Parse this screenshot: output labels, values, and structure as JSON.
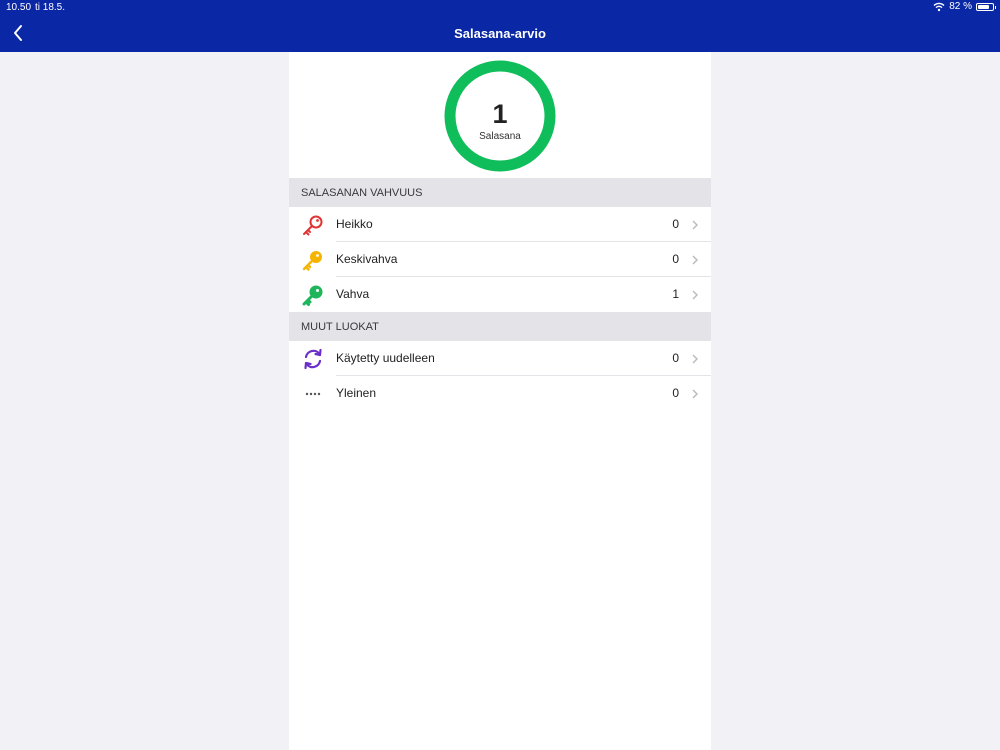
{
  "status_bar": {
    "time": "10.50",
    "date": "ti 18.5.",
    "battery": "82 %",
    "battery_level": 0.82
  },
  "nav": {
    "title": "Salasana-arvio",
    "back_icon": "chevron-left-icon"
  },
  "summary": {
    "count": "1",
    "label": "Salasana",
    "ring_color": "#0fbe5a"
  },
  "sections": [
    {
      "header": "SALASANAN VAHVUUS",
      "rows": [
        {
          "label": "Heikko",
          "count": "0",
          "icon": "key-red-icon",
          "color": "#e03434"
        },
        {
          "label": "Keskivahva",
          "count": "0",
          "icon": "key-yellow-icon",
          "color": "#f5b400"
        },
        {
          "label": "Vahva",
          "count": "1",
          "icon": "key-green-icon",
          "color": "#1fb55a"
        }
      ]
    },
    {
      "header": "MUUT LUOKAT",
      "rows": [
        {
          "label": "Käytetty uudelleen",
          "count": "0",
          "icon": "refresh-purple-icon",
          "color": "#6a2fc7"
        },
        {
          "label": "Yleinen",
          "count": "0",
          "icon": "dots-icon",
          "color": "#555555"
        }
      ]
    }
  ]
}
